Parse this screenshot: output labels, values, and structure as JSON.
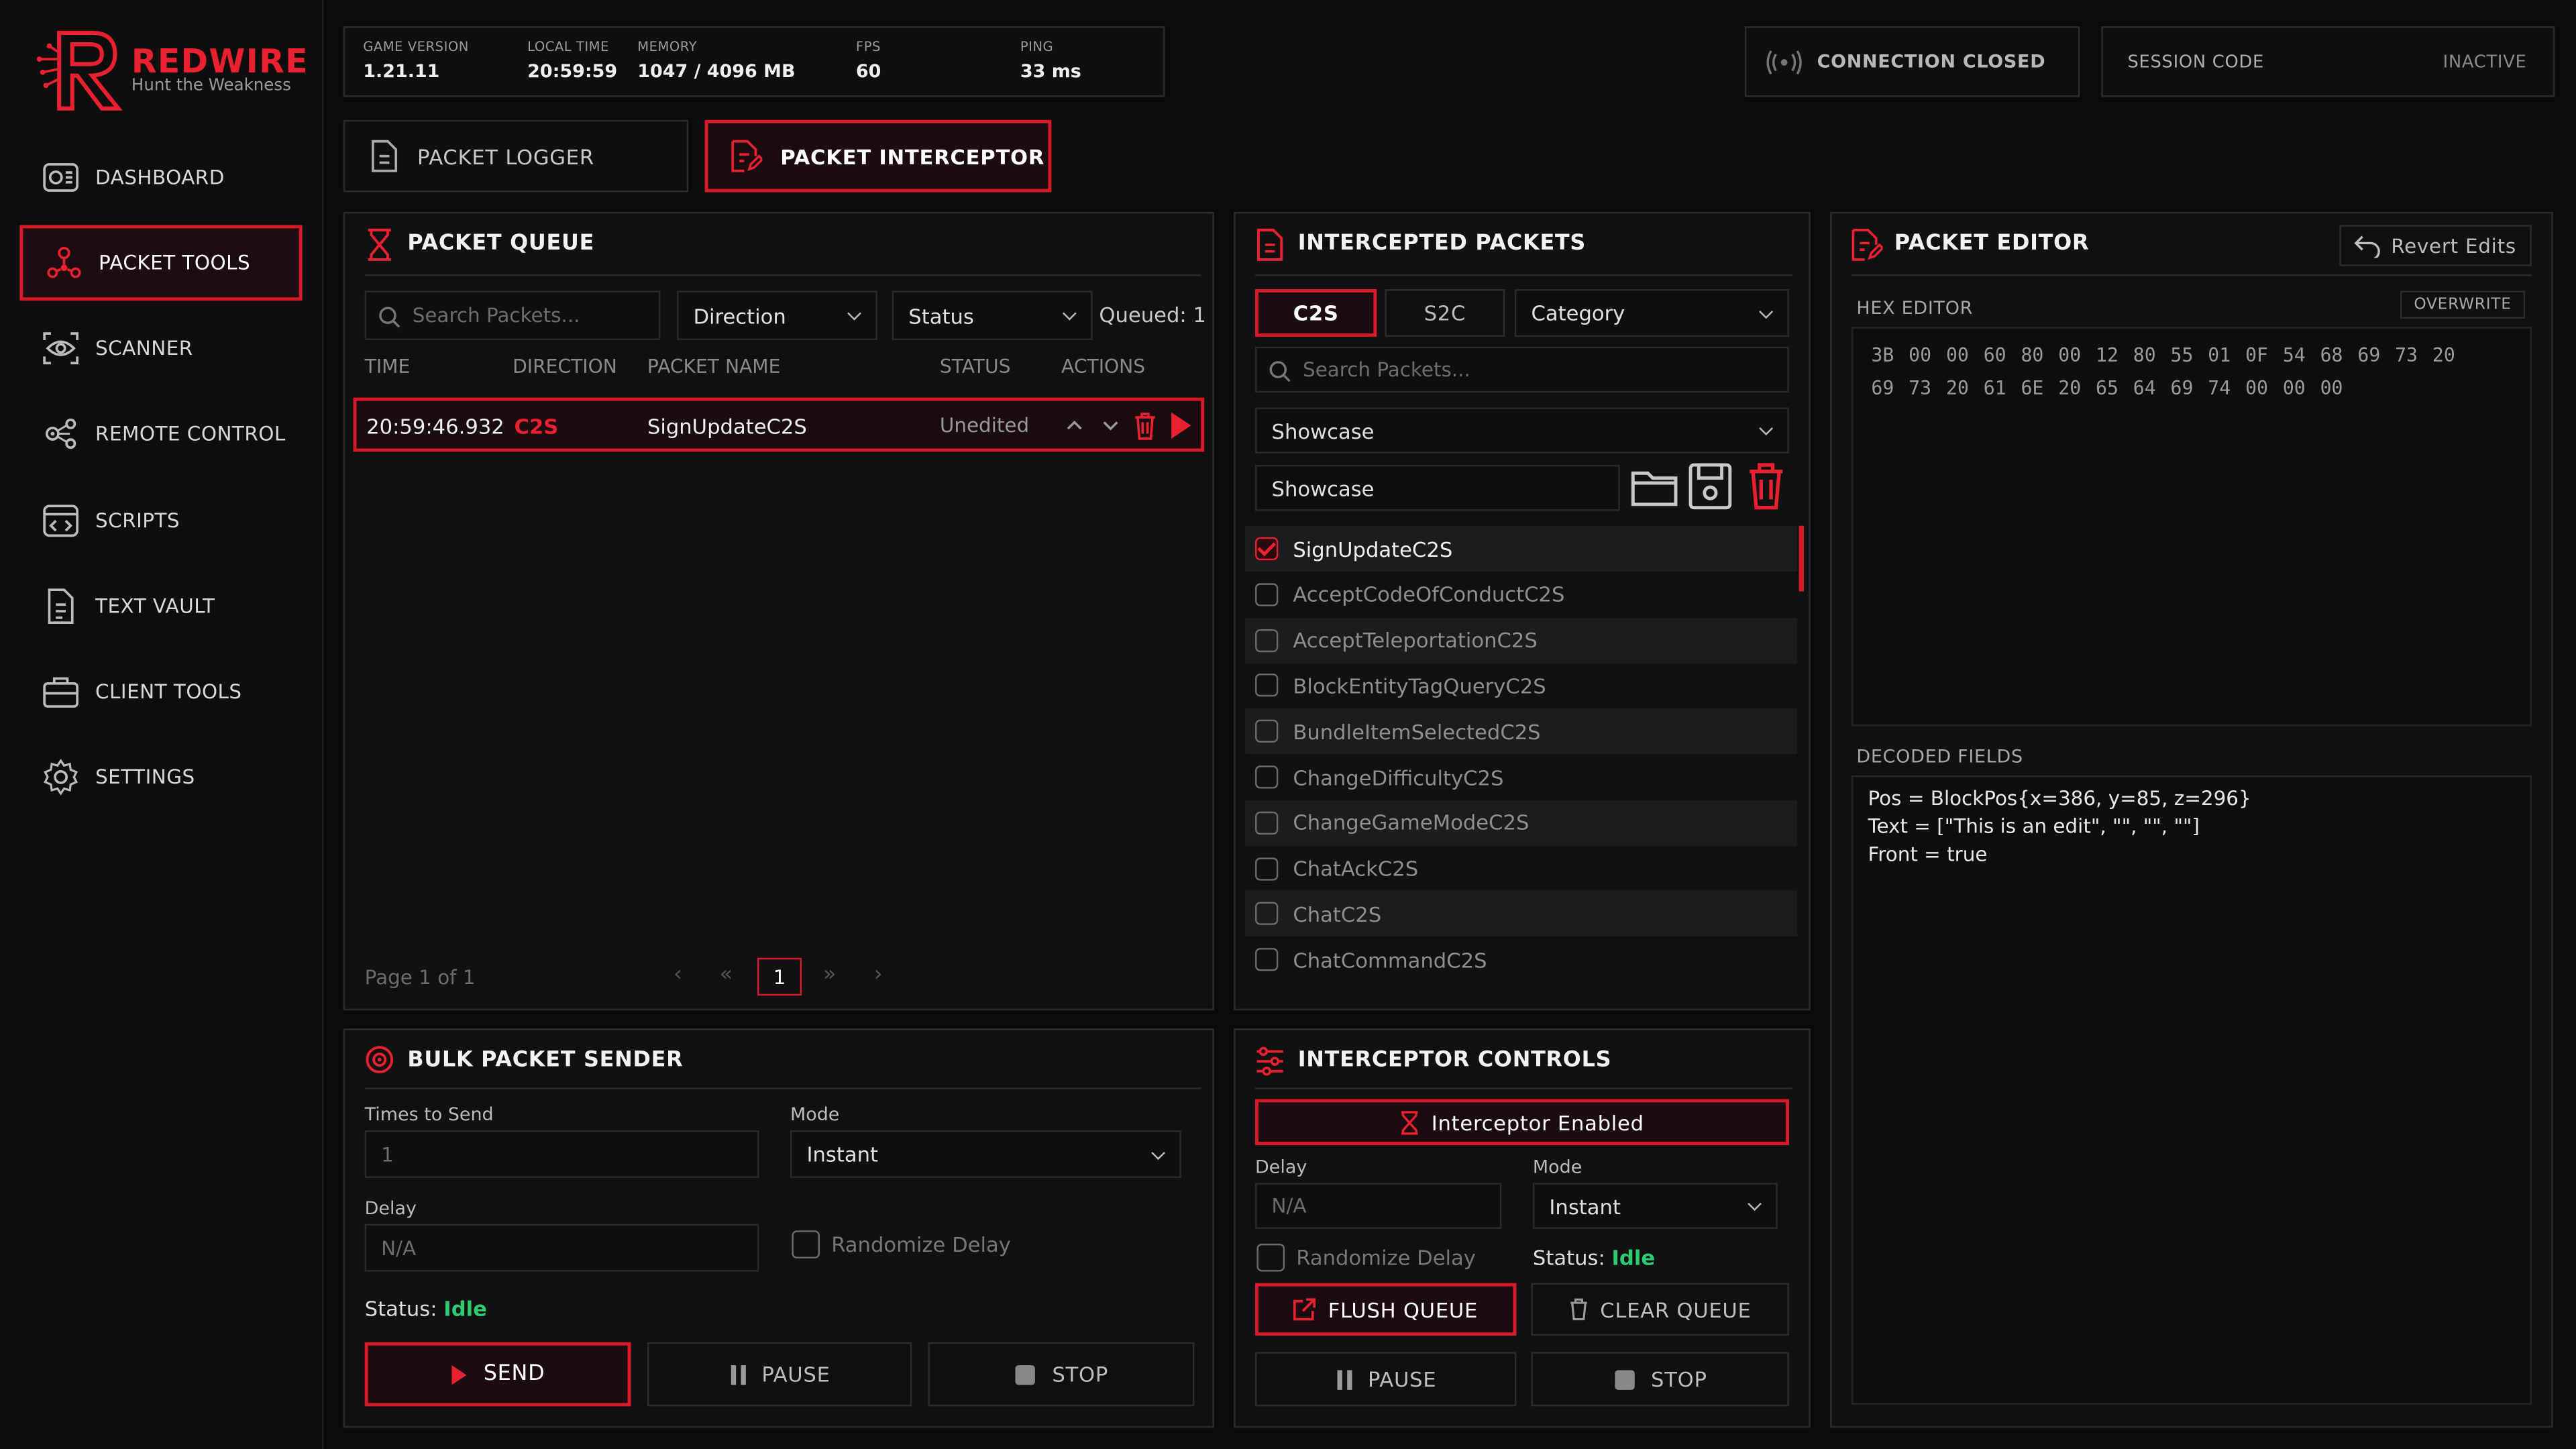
{
  "brand": {
    "name": "REDWIRE",
    "tagline": "Hunt the Weakness"
  },
  "nav": [
    {
      "label": "DASHBOARD",
      "icon": "dashboard-icon"
    },
    {
      "label": "PACKET TOOLS",
      "icon": "network-icon",
      "active": true
    },
    {
      "label": "SCANNER",
      "icon": "eye-icon"
    },
    {
      "label": "REMOTE CONTROL",
      "icon": "cogs-icon"
    },
    {
      "label": "SCRIPTS",
      "icon": "code-window-icon"
    },
    {
      "label": "TEXT VAULT",
      "icon": "document-icon"
    },
    {
      "label": "CLIENT TOOLS",
      "icon": "briefcase-icon"
    },
    {
      "label": "SETTINGS",
      "icon": "gear-icon"
    }
  ],
  "stats": {
    "game_version_label": "GAME VERSION",
    "game_version": "1.21.11",
    "local_time_label": "LOCAL TIME",
    "local_time": "20:59:59",
    "memory_label": "MEMORY",
    "memory": "1047 / 4096 MB",
    "fps_label": "FPS",
    "fps": "60",
    "ping_label": "PING",
    "ping": "33 ms"
  },
  "connection": {
    "status": "CONNECTION CLOSED"
  },
  "session": {
    "label": "SESSION CODE",
    "value": "INACTIVE"
  },
  "tabs": [
    {
      "label": "PACKET LOGGER"
    },
    {
      "label": "PACKET INTERCEPTOR",
      "active": true
    }
  ],
  "queue": {
    "title": "PACKET QUEUE",
    "search_placeholder": "Search Packets...",
    "direction": "Direction",
    "status": "Status",
    "queued": "Queued: 1",
    "columns": [
      "TIME",
      "DIRECTION",
      "PACKET NAME",
      "STATUS",
      "ACTIONS"
    ],
    "rows": [
      {
        "time": "20:59:46.932",
        "direction": "C2S",
        "name": "SignUpdateC2S",
        "status": "Unedited"
      }
    ],
    "page_info": "Page 1 of 1",
    "page": "1"
  },
  "intercepted": {
    "title": "INTERCEPTED PACKETS",
    "tab_c2s": "C2S",
    "tab_s2c": "S2C",
    "category": "Category",
    "search_placeholder": "Search Packets...",
    "preset_select": "Showcase",
    "preset_name": "Showcase",
    "items": [
      {
        "name": "SignUpdateC2S",
        "checked": true
      },
      {
        "name": "AcceptCodeOfConductC2S"
      },
      {
        "name": "AcceptTeleportationC2S"
      },
      {
        "name": "BlockEntityTagQueryC2S"
      },
      {
        "name": "BundleItemSelectedC2S"
      },
      {
        "name": "ChangeDifficultyC2S"
      },
      {
        "name": "ChangeGameModeC2S"
      },
      {
        "name": "ChatAckC2S"
      },
      {
        "name": "ChatC2S"
      },
      {
        "name": "ChatCommandC2S"
      }
    ]
  },
  "editor": {
    "title": "PACKET EDITOR",
    "revert": "Revert Edits",
    "hex_label": "HEX EDITOR",
    "mode": "OVERWRITE",
    "hex_lines": [
      "3B  00  00  60  80  00  12  80  55  01  0F  54  68  69  73  20",
      "69  73  20  61  6E  20  65  64  69  74  00  00  00"
    ],
    "decoded_label": "DECODED FIELDS",
    "decoded": [
      "Pos = BlockPos{x=386, y=85, z=296}",
      "Text = [\"This is an edit\", \"\", \"\", \"\"]",
      "Front = true"
    ]
  },
  "bulk": {
    "title": "BULK PACKET SENDER",
    "times_label": "Times to Send",
    "times_placeholder": "1",
    "mode_label": "Mode",
    "mode": "Instant",
    "delay_label": "Delay",
    "delay_placeholder": "N/A",
    "randomize": "Randomize Delay",
    "status_label": "Status:",
    "status": "Idle",
    "send": "SEND",
    "pause": "PAUSE",
    "stop": "STOP"
  },
  "controls": {
    "title": "INTERCEPTOR CONTROLS",
    "enabled": "Interceptor Enabled",
    "delay_label": "Delay",
    "delay_placeholder": "N/A",
    "mode_label": "Mode",
    "mode": "Instant",
    "randomize": "Randomize Delay",
    "status_label": "Status:",
    "status": "Idle",
    "flush": "FLUSH QUEUE",
    "clear": "CLEAR QUEUE",
    "pause": "PAUSE",
    "stop": "STOP"
  },
  "colors": {
    "accent": "#e8202f",
    "idle": "#2ecc71"
  }
}
